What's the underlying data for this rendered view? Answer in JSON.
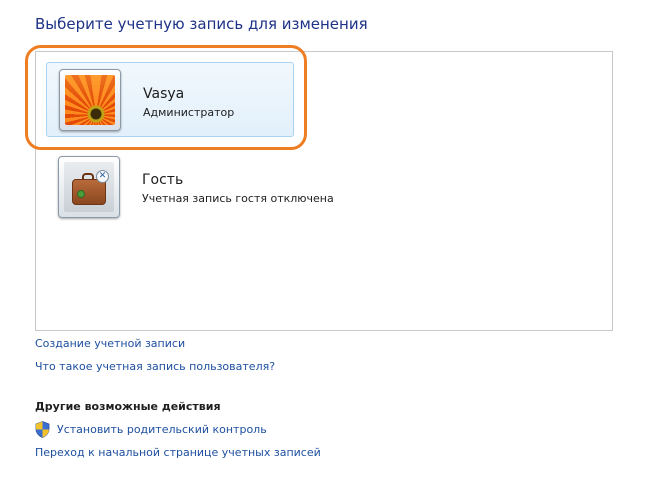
{
  "header": {
    "title": "Выберите учетную запись для изменения"
  },
  "accounts": [
    {
      "name": "Vasya",
      "description": "Администратор",
      "avatar_icon": "flower-avatar-icon",
      "selected": true
    },
    {
      "name": "Гость",
      "description": "Учетная запись гостя отключена",
      "avatar_icon": "guest-suitcase-icon",
      "selected": false
    }
  ],
  "links": {
    "create_account": "Создание учетной записи",
    "what_is_account": "Что такое учетная запись пользователя?"
  },
  "other_actions": {
    "heading": "Другие возможные действия",
    "items": [
      {
        "label": "Установить родительский контроль",
        "icon": "uac-shield-icon"
      },
      {
        "label": "Переход к начальной странице учетных записей",
        "icon": ""
      }
    ]
  },
  "colors": {
    "title": "#1e3287",
    "link": "#1e4fa0",
    "highlight_ring": "#ef7d22",
    "selection_border": "#a8d3f1"
  }
}
